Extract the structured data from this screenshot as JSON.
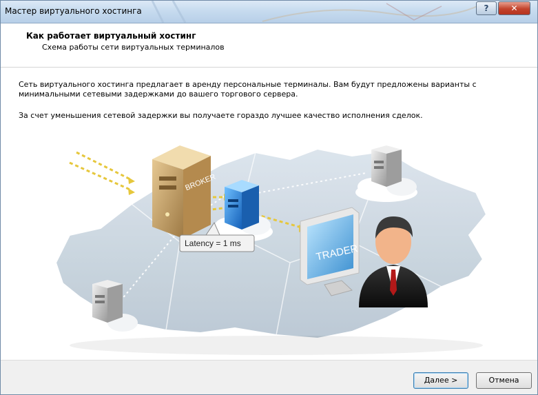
{
  "window": {
    "title": "Мастер виртуального хостинга"
  },
  "titlebar": {
    "help_icon": "question-mark-icon",
    "help_label": "?",
    "close_icon": "close-x-icon",
    "close_label": "✕"
  },
  "header": {
    "title": "Как работает виртуальный хостинг",
    "subtitle": "Схема работы сети виртуальных терминалов"
  },
  "content": {
    "paragraph1": "Сеть виртуального хостинга предлагает в аренду персональные терминалы. Вам будут предложены варианты с минимальными сетевыми задержками до вашего торгового сервера.",
    "paragraph2": "За счет уменьшения сетевой задержки вы получаете гораздо лучшее качество исполнения сделок."
  },
  "illustration": {
    "broker_label": "BROKER",
    "trader_label": "TRADER",
    "latency_label": "Latency = 1 ms",
    "colors": {
      "map": "#c9d5df",
      "broker": "#c9a46b",
      "virtual_server": "#2f8fe0",
      "remote_server": "#c8c8c8",
      "link": "#e6c73c"
    }
  },
  "footer": {
    "next_label": "Далее >",
    "cancel_label": "Отмена"
  }
}
